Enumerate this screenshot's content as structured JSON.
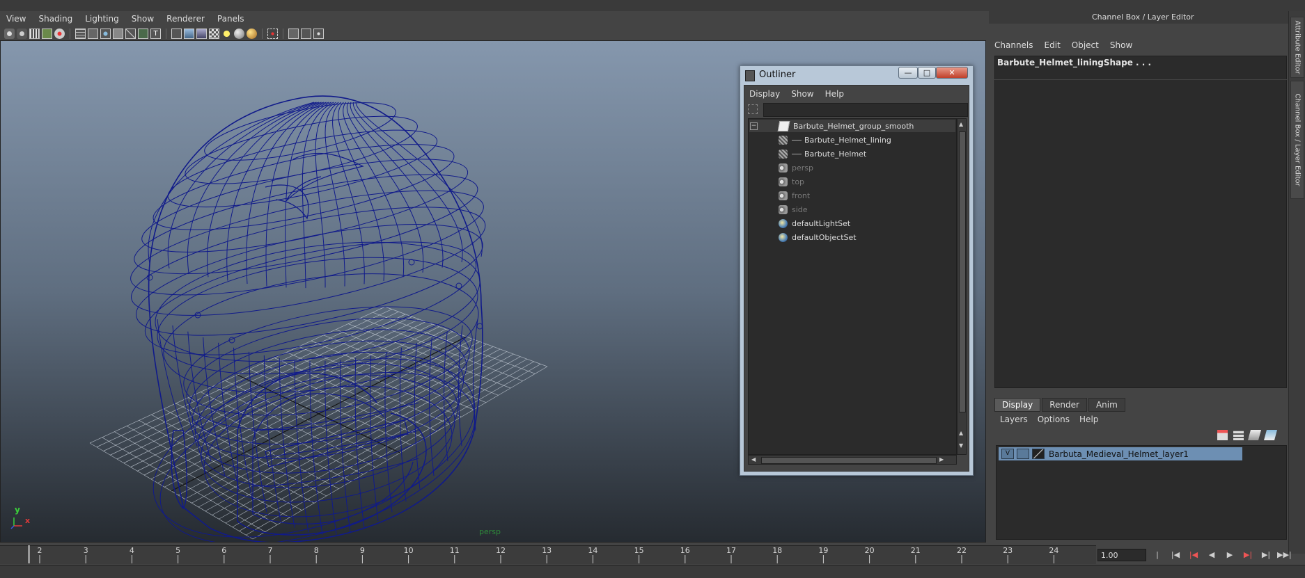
{
  "menubar": [
    "View",
    "Shading",
    "Lighting",
    "Show",
    "Renderer",
    "Panels"
  ],
  "viewport": {
    "camera_label": "persp",
    "axis_y": "y",
    "axis_x": "x"
  },
  "right_panel": {
    "title": "Channel Box / Layer Editor",
    "menu": [
      "Channels",
      "Edit",
      "Object",
      "Show"
    ],
    "shape_name": "Barbute_Helmet_liningShape . . .",
    "dock_tabs": [
      "Attribute Editor",
      "Channel Box / Layer Editor"
    ]
  },
  "layer_editor": {
    "tabs": [
      "Display",
      "Render",
      "Anim"
    ],
    "active_tab": "Display",
    "menu": [
      "Layers",
      "Options",
      "Help"
    ],
    "layer": {
      "visible_flag": "V",
      "name": "Barbuta_Medieval_Helmet_layer1"
    }
  },
  "outliner": {
    "title": "Outliner",
    "menu": [
      "Display",
      "Show",
      "Help"
    ],
    "window_buttons": {
      "minimize": "—",
      "maximize": "□",
      "close": "✕"
    },
    "items": [
      {
        "name": "Barbute_Helmet_group_smooth",
        "icon": "group-icon",
        "depth": 0,
        "dimmed": false,
        "selected": true
      },
      {
        "name": "Barbute_Helmet_lining",
        "icon": "mesh-icon",
        "depth": 1,
        "dimmed": false,
        "selected": false
      },
      {
        "name": "Barbute_Helmet",
        "icon": "mesh-icon",
        "depth": 1,
        "dimmed": false,
        "selected": false
      },
      {
        "name": "persp",
        "icon": "camera-icon",
        "depth": 0,
        "dimmed": true,
        "selected": false
      },
      {
        "name": "top",
        "icon": "camera-icon",
        "depth": 0,
        "dimmed": true,
        "selected": false
      },
      {
        "name": "front",
        "icon": "camera-icon",
        "depth": 0,
        "dimmed": true,
        "selected": false
      },
      {
        "name": "side",
        "icon": "camera-icon",
        "depth": 0,
        "dimmed": true,
        "selected": false
      },
      {
        "name": "defaultLightSet",
        "icon": "set-icon",
        "depth": 0,
        "dimmed": false,
        "selected": false
      },
      {
        "name": "defaultObjectSet",
        "icon": "set-icon",
        "depth": 0,
        "dimmed": false,
        "selected": false
      }
    ]
  },
  "timeline": {
    "ticks": [
      2,
      3,
      4,
      5,
      6,
      7,
      8,
      9,
      10,
      11,
      12,
      13,
      14,
      15,
      16,
      17,
      18,
      19,
      20,
      21,
      22,
      23,
      24
    ],
    "current_frame": "1.00"
  },
  "colors": {
    "wireframe": "#101a8a",
    "selection": "#6d8fb3",
    "persp_label": "#2e8b3a"
  }
}
